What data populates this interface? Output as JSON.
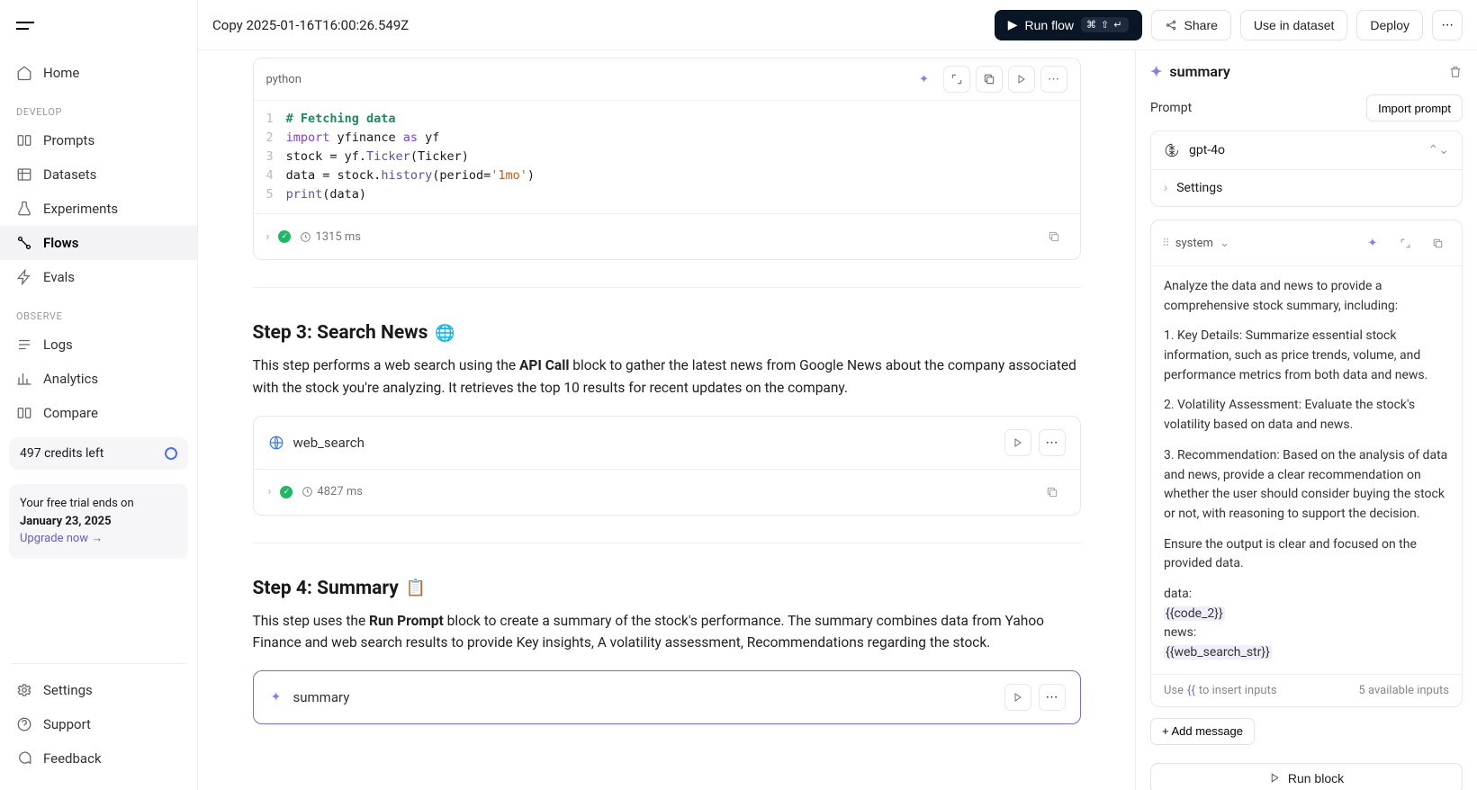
{
  "header": {
    "title": "Copy 2025-01-16T16:00:26.549Z",
    "run_flow": "Run flow",
    "run_flow_kbd": "⌘ ⇧ ↵",
    "share": "Share",
    "use_in_dataset": "Use in dataset",
    "deploy": "Deploy"
  },
  "sidebar": {
    "home": "Home",
    "sections": {
      "develop": "DEVELOP",
      "observe": "OBSERVE"
    },
    "items": {
      "prompts": "Prompts",
      "datasets": "Datasets",
      "experiments": "Experiments",
      "flows": "Flows",
      "evals": "Evals",
      "logs": "Logs",
      "analytics": "Analytics",
      "compare": "Compare",
      "settings": "Settings",
      "support": "Support",
      "feedback": "Feedback"
    },
    "credits": "497 credits left",
    "trial_l1": "Your free trial ends on",
    "trial_date": "January 23, 2025",
    "trial_upgrade": "Upgrade now →"
  },
  "code_block": {
    "lang": "python",
    "lines": {
      "l1_comment": "# Fetching data",
      "l2a": "import",
      "l2b": " yfinance ",
      "l2c": "as",
      "l2d": " yf",
      "l3a": "stock = yf.",
      "l3b": "Ticker",
      "l3c": "(Ticker)",
      "l4a": "data = stock.",
      "l4b": "history",
      "l4c": "(period=",
      "l4d": "'1mo'",
      "l4e": ")",
      "l5a": "print",
      "l5b": "(data)"
    },
    "duration": "1315 ms"
  },
  "step3": {
    "heading": "Step 3: Search News",
    "emoji": "🌐",
    "p_before": "This step performs a web search using the ",
    "p_bold": "API Call",
    "p_after": " block to gather the latest news from Google News about the company associated with the stock you're analyzing. It retrieves the top 10 results for recent updates on the company."
  },
  "web_search": {
    "name": "web_search",
    "duration": "4827 ms"
  },
  "step4": {
    "heading": "Step 4: Summary",
    "emoji": "📋",
    "p_before": "This step uses the ",
    "p_bold": "Run Prompt",
    "p_after": " block to create a summary of the stock's performance. The summary combines data from Yahoo Finance and web search results to provide Key insights, A volatility assessment, Recommendations regarding the stock."
  },
  "summary_block": {
    "name": "summary"
  },
  "rpanel": {
    "title": "summary",
    "prompt_label": "Prompt",
    "import_prompt": "Import prompt",
    "model": "gpt-4o",
    "settings": "Settings",
    "role": "system",
    "body": {
      "p1": "Analyze the data and news to provide a comprehensive stock summary, including:",
      "p2": "1. Key Details: Summarize essential stock information, such as price trends, volume, and performance metrics from both data and news.",
      "p3": "2. Volatility Assessment: Evaluate the stock's volatility based on data and news.",
      "p4": "3. Recommendation: Based on the analysis of data and news, provide a clear recommendation on whether the user should consider buying the stock or not, with reasoning to support the decision.",
      "p5": "Ensure the output is clear and focused on the provided data.",
      "p6a": "data:",
      "p6b": "{{code_2}}",
      "p7a": "news:",
      "p7b": "{{web_search_str}}"
    },
    "hint_pre": "Use ",
    "hint_tok": "{{",
    "hint_post": " to insert inputs",
    "avail": "5 available inputs",
    "add_message": "+ Add message",
    "run_block": "Run block"
  }
}
